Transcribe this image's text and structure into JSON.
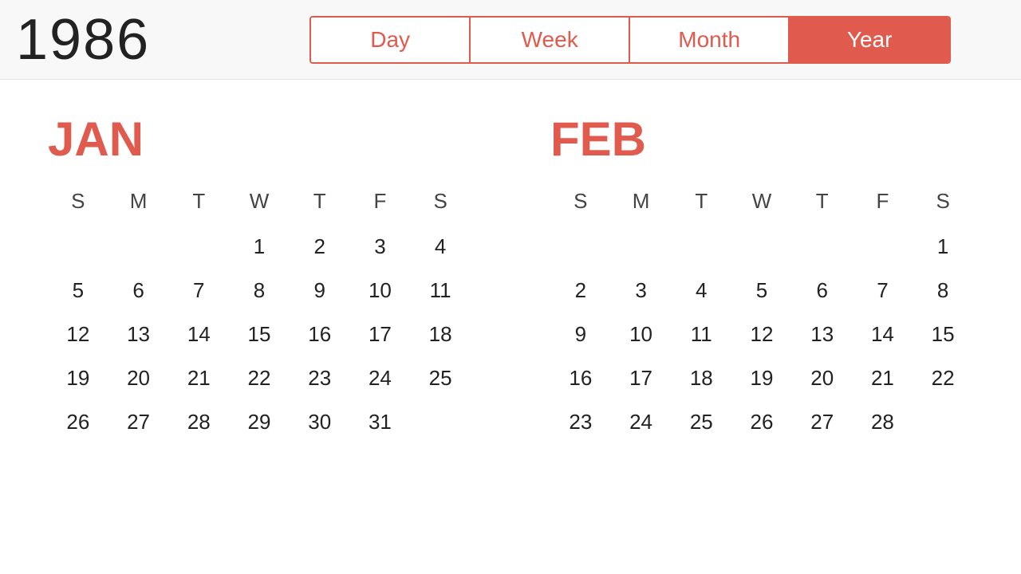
{
  "header": {
    "year": "1986",
    "tabs": [
      {
        "label": "Day",
        "active": false
      },
      {
        "label": "Week",
        "active": false
      },
      {
        "label": "Month",
        "active": false
      },
      {
        "label": "Year",
        "active": true
      }
    ]
  },
  "calendars": [
    {
      "monthName": "JAN",
      "dayHeaders": [
        "S",
        "M",
        "T",
        "W",
        "T",
        "F",
        "S"
      ],
      "weeks": [
        [
          "",
          "",
          "",
          "1",
          "2",
          "3",
          "4"
        ],
        [
          "5",
          "6",
          "7",
          "8",
          "9",
          "10",
          "11"
        ],
        [
          "12",
          "13",
          "14",
          "15",
          "16",
          "17",
          "18"
        ],
        [
          "19",
          "20",
          "21",
          "22",
          "23",
          "24",
          "25"
        ],
        [
          "26",
          "27",
          "28",
          "29",
          "30",
          "31",
          ""
        ]
      ]
    },
    {
      "monthName": "FEB",
      "dayHeaders": [
        "S",
        "M",
        "T",
        "W",
        "T",
        "F",
        "S"
      ],
      "weeks": [
        [
          "",
          "",
          "",
          "",
          "",
          "",
          "1"
        ],
        [
          "2",
          "3",
          "4",
          "5",
          "6",
          "7",
          "8"
        ],
        [
          "9",
          "10",
          "11",
          "12",
          "13",
          "14",
          "15"
        ],
        [
          "16",
          "17",
          "18",
          "19",
          "20",
          "21",
          "22"
        ],
        [
          "23",
          "24",
          "25",
          "26",
          "27",
          "28",
          ""
        ]
      ]
    }
  ]
}
